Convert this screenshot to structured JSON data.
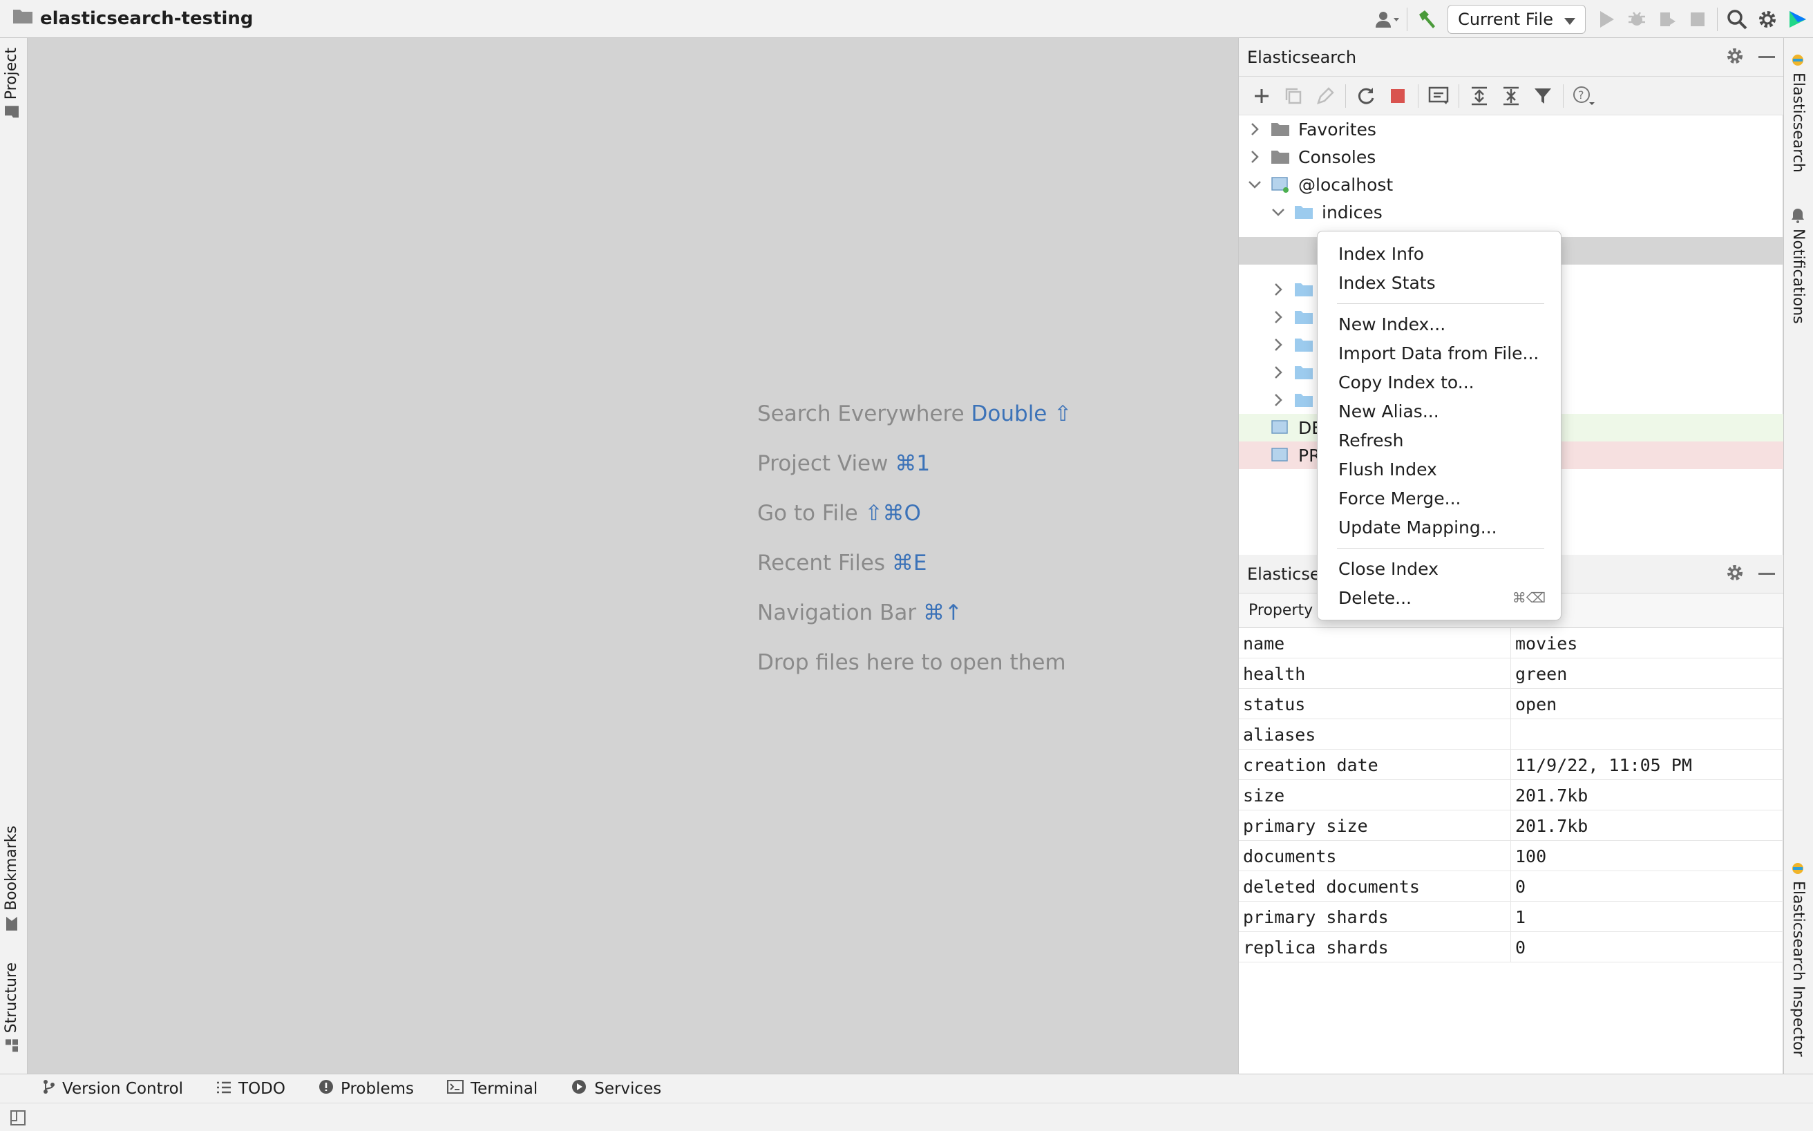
{
  "window": {
    "project_name": "elasticsearch-testing"
  },
  "run_config": {
    "label": "Current File"
  },
  "left_tabs": {
    "project": "Project",
    "bookmarks": "Bookmarks",
    "structure": "Structure"
  },
  "right_tabs": {
    "elasticsearch": "Elasticsearch",
    "notifications": "Notifications",
    "inspector": "Elasticsearch Inspector"
  },
  "editor_hints": [
    {
      "text": "Search Everywhere",
      "shortcut": "Double ⇧"
    },
    {
      "text": "Project View",
      "shortcut": "⌘1"
    },
    {
      "text": "Go to File",
      "shortcut": "⇧⌘O"
    },
    {
      "text": "Recent Files",
      "shortcut": "⌘E"
    },
    {
      "text": "Navigation Bar",
      "shortcut": "⌘↑"
    },
    {
      "text": "Drop files here to open them",
      "shortcut": ""
    }
  ],
  "es_panel": {
    "title": "Elasticsearch",
    "tree": {
      "favorites": "Favorites",
      "consoles": "Consoles",
      "connection": "@localhost",
      "indices": "indices",
      "dev_prefix": "DE",
      "prod_prefix": "PR"
    }
  },
  "inspector_panel": {
    "title": "Elasticse",
    "property_header": "Property",
    "rows": [
      {
        "key": "name",
        "value": "movies"
      },
      {
        "key": "health",
        "value": "green"
      },
      {
        "key": "status",
        "value": "open"
      },
      {
        "key": "aliases",
        "value": ""
      },
      {
        "key": "creation date",
        "value": "11/9/22, 11:05 PM"
      },
      {
        "key": "size",
        "value": "201.7kb"
      },
      {
        "key": "primary size",
        "value": "201.7kb"
      },
      {
        "key": "documents",
        "value": "100"
      },
      {
        "key": "deleted documents",
        "value": "0"
      },
      {
        "key": "primary shards",
        "value": "1"
      },
      {
        "key": "replica shards",
        "value": "0"
      }
    ]
  },
  "context_menu": {
    "items": {
      "index_info": "Index Info",
      "index_stats": "Index Stats",
      "new_index": "New Index...",
      "import_data": "Import Data from File...",
      "copy_index": "Copy Index to...",
      "new_alias": "New Alias...",
      "refresh": "Refresh",
      "flush_index": "Flush Index",
      "force_merge": "Force Merge...",
      "update_mapping": "Update Mapping...",
      "close_index": "Close Index",
      "delete": "Delete..."
    },
    "delete_shortcut": "⌘⌫"
  },
  "bottom_tabs": {
    "version_control": "Version Control",
    "todo": "TODO",
    "problems": "Problems",
    "terminal": "Terminal",
    "services": "Services"
  }
}
